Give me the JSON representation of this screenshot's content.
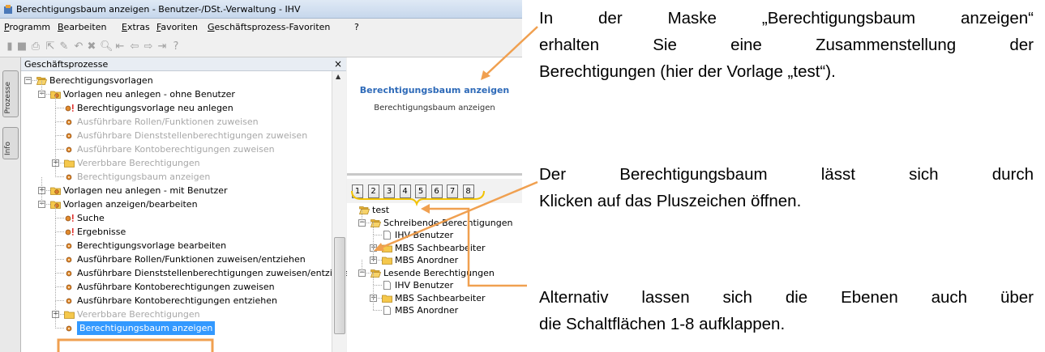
{
  "window": {
    "title": "Berechtigungsbaum anzeigen - Benutzer-/DSt.-Verwaltung - IHV"
  },
  "menubar": {
    "items": [
      "Programm",
      "Bearbeiten",
      "Extras",
      "Favoriten",
      "Geschäftsprozess-Favoriten",
      "?"
    ]
  },
  "toolbar": {
    "icons": [
      "new-icon",
      "save-icon",
      "print-icon",
      "export-icon",
      "edit-icon",
      "undo-icon",
      "delete-icon",
      "search-icon",
      "first-icon",
      "back-icon",
      "forward-icon",
      "last-icon",
      "help-icon"
    ]
  },
  "sidetabs": [
    "Prozesse",
    "Info"
  ],
  "process_panel": {
    "header": "Geschäftsprozesse",
    "close": "×",
    "tree": [
      {
        "label": "Berechtigungsvorlagen",
        "level": 0,
        "icon": "folder-open",
        "toggle": "−",
        "state": "normal"
      },
      {
        "label": "Vorlagen neu anlegen - ohne Benutzer",
        "level": 1,
        "icon": "process-folder",
        "toggle": "−",
        "state": "normal"
      },
      {
        "label": "Berechtigungsvorlage neu anlegen",
        "level": 2,
        "icon": "process-start",
        "toggle": "",
        "state": "normal"
      },
      {
        "label": "Ausführbare Rollen/Funktionen zuweisen",
        "level": 2,
        "icon": "process-step",
        "toggle": "",
        "state": "grey"
      },
      {
        "label": "Ausführbare Dienststellenberechtigungen zuweisen",
        "level": 2,
        "icon": "process-step",
        "toggle": "",
        "state": "grey"
      },
      {
        "label": "Ausführbare Kontoberechtigungen zuweisen",
        "level": 2,
        "icon": "process-step",
        "toggle": "",
        "state": "grey"
      },
      {
        "label": "Vererbbare Berechtigungen",
        "level": 2,
        "icon": "folder",
        "toggle": "+",
        "state": "grey"
      },
      {
        "label": "Berechtigungsbaum anzeigen",
        "level": 2,
        "icon": "process-step",
        "toggle": "",
        "state": "grey"
      },
      {
        "label": "Vorlagen neu anlegen - mit Benutzer",
        "level": 1,
        "icon": "process-folder",
        "toggle": "+",
        "state": "normal"
      },
      {
        "label": "Vorlagen anzeigen/bearbeiten",
        "level": 1,
        "icon": "process-folder",
        "toggle": "−",
        "state": "normal"
      },
      {
        "label": "Suche",
        "level": 2,
        "icon": "process-start",
        "toggle": "",
        "state": "normal"
      },
      {
        "label": "Ergebnisse",
        "level": 2,
        "icon": "process-start",
        "toggle": "",
        "state": "normal"
      },
      {
        "label": "Berechtigungsvorlage bearbeiten",
        "level": 2,
        "icon": "process-step",
        "toggle": "",
        "state": "normal"
      },
      {
        "label": "Ausführbare Rollen/Funktionen zuweisen/entziehen",
        "level": 2,
        "icon": "process-step",
        "toggle": "",
        "state": "normal"
      },
      {
        "label": "Ausführbare Dienststellenberechtigungen zuweisen/entziehen",
        "level": 2,
        "icon": "process-step",
        "toggle": "",
        "state": "normal"
      },
      {
        "label": "Ausführbare Kontoberechtigungen zuweisen",
        "level": 2,
        "icon": "process-step",
        "toggle": "",
        "state": "normal"
      },
      {
        "label": "Ausführbare Kontoberechtigungen entziehen",
        "level": 2,
        "icon": "process-step",
        "toggle": "",
        "state": "normal"
      },
      {
        "label": "Vererbbare Berechtigungen",
        "level": 2,
        "icon": "folder",
        "toggle": "+",
        "state": "grey"
      },
      {
        "label": "Berechtigungsbaum anzeigen",
        "level": 2,
        "icon": "process-step",
        "toggle": "",
        "state": "selected"
      }
    ]
  },
  "right_panel": {
    "title": "Berechtigungsbaum anzeigen",
    "subtitle": "Berechtigungsbaum anzeigen",
    "level_buttons": [
      "1",
      "2",
      "3",
      "4",
      "5",
      "6",
      "7",
      "8"
    ],
    "tree": [
      {
        "label": "test",
        "level": 0,
        "icon": "folder-open",
        "toggle": ""
      },
      {
        "label": "Schreibende Berechtigungen",
        "level": 1,
        "icon": "folder-open",
        "toggle": "−"
      },
      {
        "label": "IHV Benutzer",
        "level": 2,
        "icon": "document",
        "toggle": ""
      },
      {
        "label": "MBS Sachbearbeiter",
        "level": 2,
        "icon": "folder",
        "toggle": "+"
      },
      {
        "label": "MBS Anordner",
        "level": 2,
        "icon": "folder",
        "toggle": "+"
      },
      {
        "label": "Lesende Berechtigungen",
        "level": 1,
        "icon": "folder-open",
        "toggle": "−"
      },
      {
        "label": "IHV Benutzer",
        "level": 2,
        "icon": "document",
        "toggle": ""
      },
      {
        "label": "MBS Sachbearbeiter",
        "level": 2,
        "icon": "folder",
        "toggle": "+"
      },
      {
        "label": "MBS Anordner",
        "level": 2,
        "icon": "document",
        "toggle": ""
      }
    ]
  },
  "callouts": [
    {
      "lines": [
        "In der Maske „Berechtigungsbaum anzeigen“",
        "erhalten Sie eine Zusammenstellung der",
        "Berechtigungen (hier der Vorlage „test“)."
      ]
    },
    {
      "lines": [
        "Der Berechtigungsbaum lässt sich durch",
        "Klicken auf das Pluszeichen öffnen."
      ]
    },
    {
      "lines": [
        "Alternativ lassen sich die Ebenen auch über",
        "die Schaltflächen 1-8 aufklappen."
      ]
    }
  ],
  "colors": {
    "accent_orange": "#f0a050",
    "selection_blue": "#3399ff",
    "title_blue": "#2e6ab8",
    "folder_yellow": "#f5c84c",
    "bracket_yellow": "#f2c200"
  }
}
